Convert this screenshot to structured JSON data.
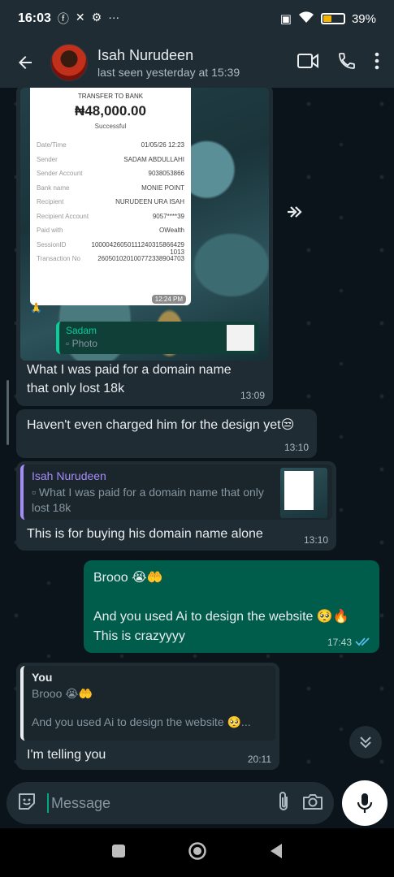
{
  "statusbar": {
    "time": "16:03",
    "battery": "39",
    "battery_unit": "%",
    "battery_level": 0.39
  },
  "header": {
    "name": "Isah Nurudeen",
    "status": "last seen yesterday at 15:39"
  },
  "receipt": {
    "title": "TRANSFER TO BANK",
    "amount": "₦48,000.00",
    "status": "Successful",
    "rows": [
      {
        "k": "Date/Time",
        "v": "01/05/26 12:23"
      },
      {
        "k": "Sender",
        "v": "SADAM ABDULLAHI"
      },
      {
        "k": "Sender Account",
        "v": "9038053866"
      },
      {
        "k": "Bank name",
        "v": "MONIE POINT"
      },
      {
        "k": "Recipient",
        "v": "NURUDEEN URA ISAH"
      },
      {
        "k": "Recipient Account",
        "v": "9057****39"
      },
      {
        "k": "Paid with",
        "v": "OWealth"
      },
      {
        "k": "SessionID",
        "v": "100004260501112403158664291013"
      },
      {
        "k": "Transaction No",
        "v": "260501020100772338904703"
      }
    ],
    "time": "12:24 PM"
  },
  "forwarded": {
    "name": "Sadam",
    "type": "Photo"
  },
  "messages": {
    "m1": {
      "text": "What I was paid for a domain name that only lost 18k",
      "time": "13:09"
    },
    "m2": {
      "text": "Haven't even charged him for the design yet😒",
      "time": "13:10"
    },
    "m3": {
      "quote_name": "Isah Nurudeen",
      "quote_text": "What I was paid for a domain name that only lost 18k",
      "text": "This is for buying his domain name alone",
      "time": "13:10"
    },
    "m4": {
      "line1": "Brooo 😭🤲",
      "line2": "And you used Ai to design the website 🥺🔥",
      "line3": "This is crazyyyy",
      "time": "17:43"
    },
    "m5": {
      "quote_name": "You",
      "quote_line1": "Brooo 😭🤲",
      "quote_line2": "And you used Ai to design the website 🥺...",
      "text": "I'm telling you",
      "time": "20:11"
    }
  },
  "composer": {
    "placeholder": "Message"
  },
  "colors": {
    "header": "#1f2c34",
    "bubble_in": "#1f2c34",
    "bubble_out": "#005c4b",
    "accent": "#00a884",
    "read_ticks": "#53bdeb"
  },
  "icons": [
    "back-arrow-icon",
    "video-call-icon",
    "voice-call-icon",
    "more-options-icon",
    "forward-icon",
    "photo-icon",
    "sticker-icon",
    "attach-icon",
    "camera-icon",
    "mic-icon",
    "double-chevron-down-icon",
    "read-ticks-icon"
  ]
}
